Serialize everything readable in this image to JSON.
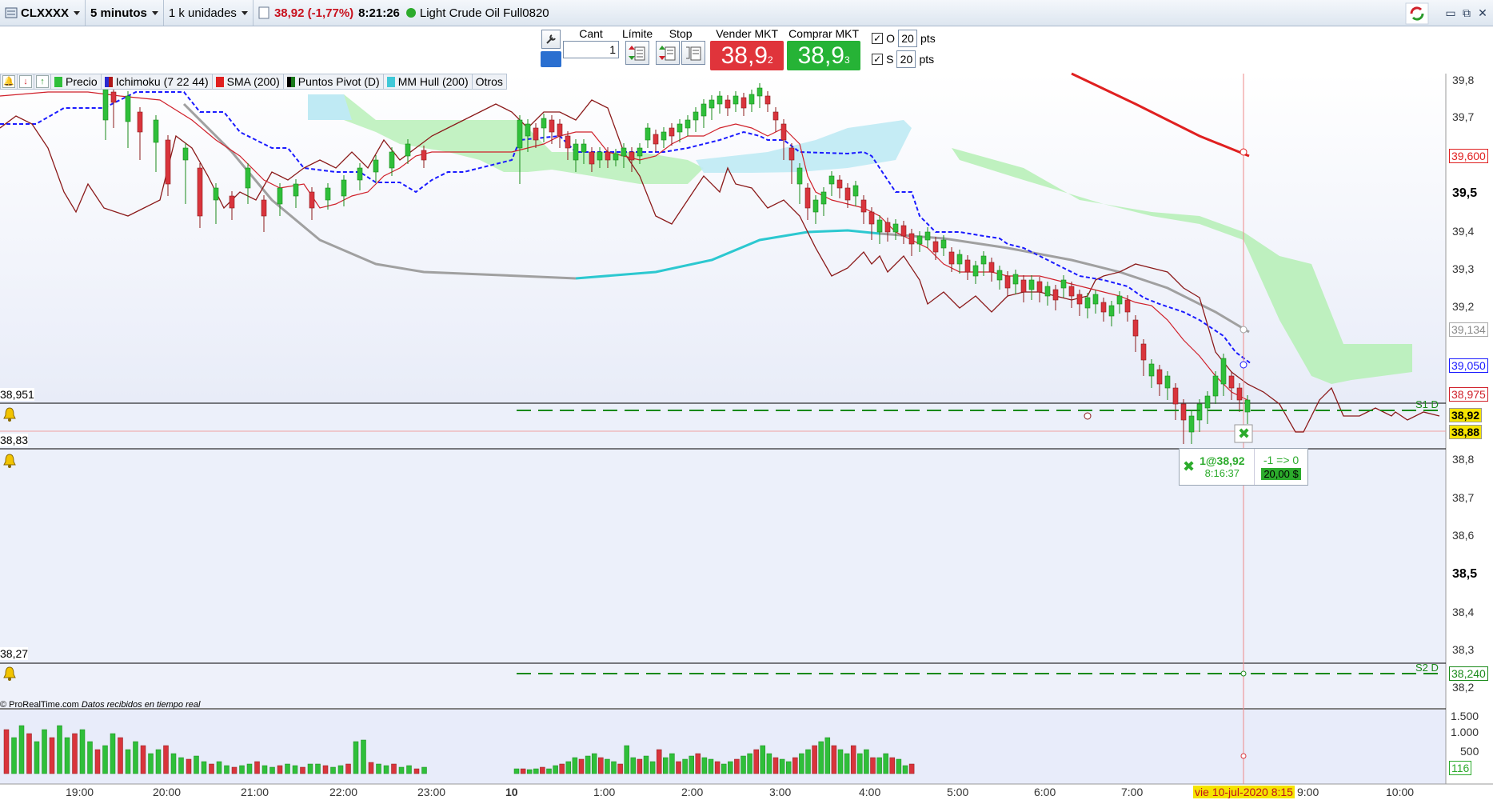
{
  "titlebar": {
    "symbol": "CLXXXX",
    "timeframe": "5 minutos",
    "units": "1 k unidades",
    "price_change": "38,92 (-1,77%)",
    "clock": "8:21:26",
    "instrument": "Light Crude Oil Full0820"
  },
  "orderbar": {
    "cant_label": "Cant",
    "cant_value": "1",
    "limit_label": "Límite",
    "stop_label": "Stop",
    "sell_label": "Vender MKT",
    "sell_price": "38,9",
    "sell_sup": "2",
    "buy_label": "Comprar MKT",
    "buy_price": "38,9",
    "buy_sup": "3",
    "o_label": "O",
    "o_pts": "20",
    "s_label": "S",
    "s_pts": "20",
    "pts_label": "pts"
  },
  "indicators": [
    {
      "label": "Precio",
      "color": "#2fbf3a"
    },
    {
      "label": "Ichimoku (7 22 44)",
      "color": "#7a2aa0"
    },
    {
      "label": "SMA (200)",
      "color": "#e02020"
    },
    {
      "label": "Puntos Pivot (D)",
      "color": "#1a7a1a"
    },
    {
      "label": "MM Hull (200)",
      "color": "#40c8d8"
    },
    {
      "label": "Otros",
      "color": ""
    }
  ],
  "left_values": {
    "upper": "38,951",
    "mid": "38,83",
    "lower": "38,27"
  },
  "axis": {
    "y_ticks": [
      "39,8",
      "39,7",
      "39,5",
      "39,4",
      "39,3",
      "39,2",
      "38,8",
      "38,7",
      "38,6",
      "38,5",
      "38,4",
      "38,3",
      "38,2"
    ],
    "bold_ticks": [
      "39,5",
      "38,5"
    ],
    "price_tags": {
      "sma": "39,600",
      "hull": "39,134",
      "ichimoku_blue": "39,050",
      "red": "38,975",
      "current": "38,92",
      "bid": "38,88",
      "s2": "38,240"
    },
    "vol_ticks": [
      "1.500",
      "1.000",
      "500"
    ],
    "vol_current": "116"
  },
  "pivots": {
    "s1": "S1 D",
    "s2": "S2 D"
  },
  "trade": {
    "fill": "1@38,92",
    "time": "8:16:37",
    "pos": "-1 => 0",
    "pnl": "20,00 $"
  },
  "footer": {
    "source": "© ProRealTime.com",
    "status": "Datos recibidos en tiempo real"
  },
  "time_axis": {
    "labels": [
      "19:00",
      "20:00",
      "21:00",
      "22:00",
      "23:00",
      "10",
      "1:00",
      "2:00",
      "3:00",
      "4:00",
      "5:00",
      "6:00",
      "7:00",
      "9:00",
      "10:00"
    ],
    "cursor": "vie 10-jul-2020 8:15"
  },
  "colors": {
    "up": "#2fbf3a",
    "down": "#d9343c",
    "cloud": "#b8f0b8",
    "cloud_alt": "#bfeaf4",
    "sma": "#e02020",
    "hull_gray": "#a0a0a0",
    "hull_cyan": "#2cc8d0",
    "kijun": "#1a1aff",
    "chikou": "#8b1a1a",
    "pivot": "#1a8a1a"
  }
}
